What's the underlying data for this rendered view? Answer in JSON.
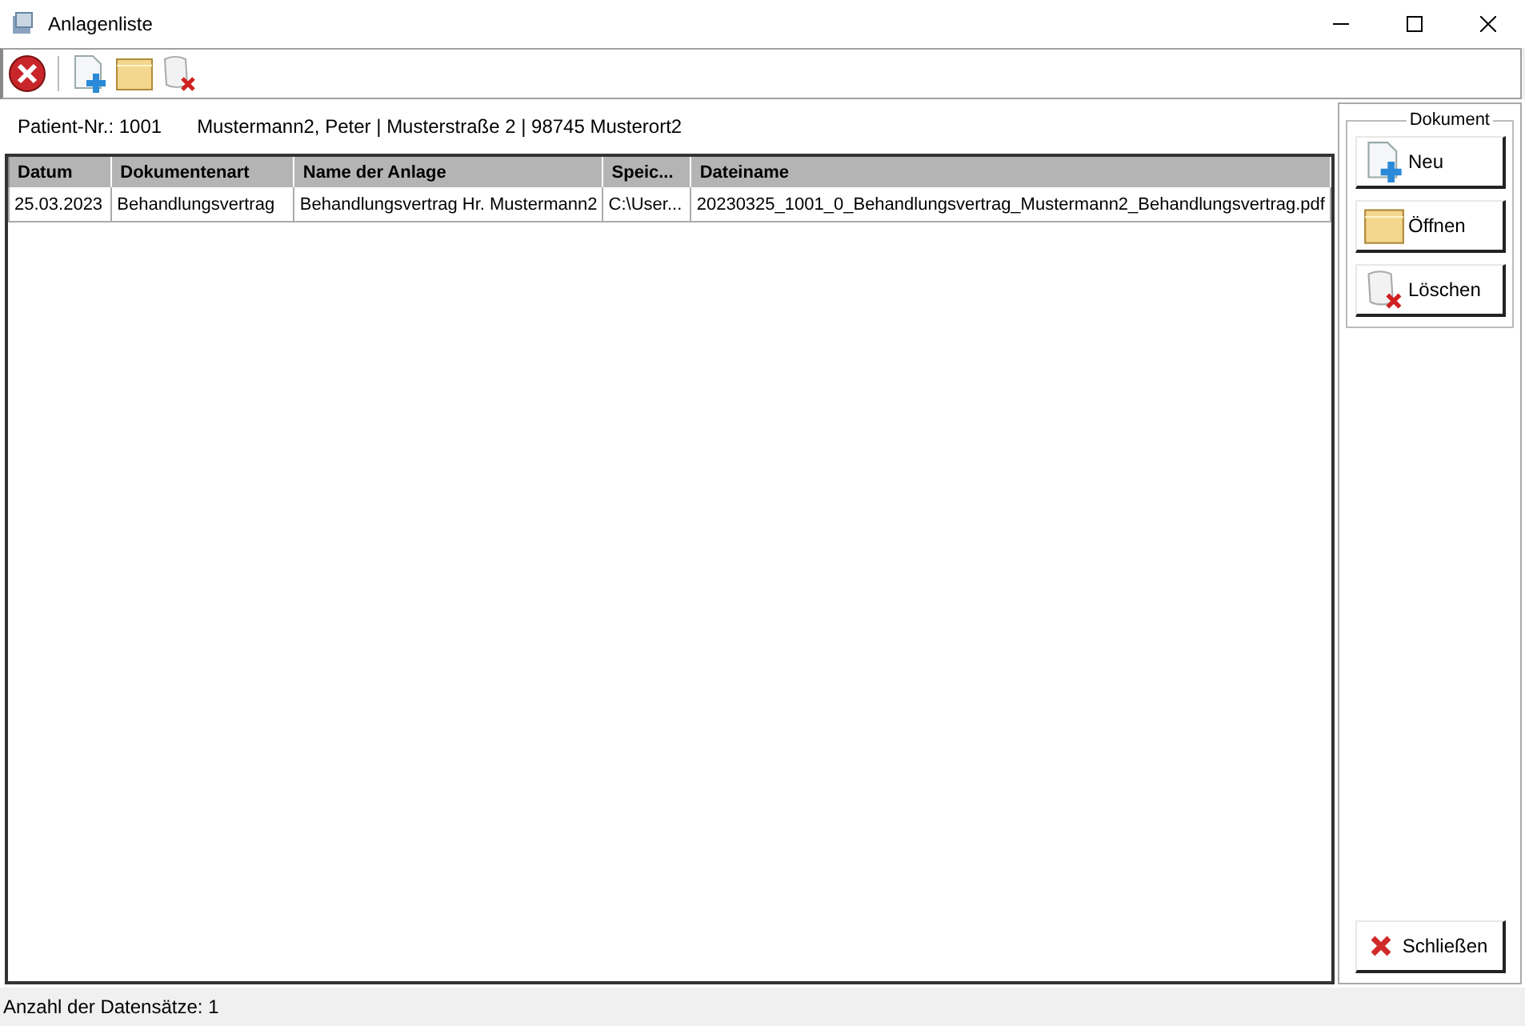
{
  "window": {
    "title": "Anlagenliste"
  },
  "toolbar": [
    {
      "kind": "close"
    },
    {
      "kind": "separator"
    },
    {
      "kind": "new"
    },
    {
      "kind": "open"
    },
    {
      "kind": "delete"
    }
  ],
  "patient": {
    "number_label": "Patient-Nr.: 1001",
    "details": "Mustermann2, Peter | Musterstraße 2 | 98745 Musterort2"
  },
  "table": {
    "columns": [
      "Datum",
      "Dokumentenart",
      "Name der Anlage",
      "Speic...",
      "Dateiname"
    ],
    "rows": [
      [
        "25.03.2023",
        "Behandlungsvertrag",
        "Behandlungsvertrag Hr. Mustermann2",
        "C:\\User...",
        "20230325_1001_0_Behandlungsvertrag_Mustermann2_Behandlungsvertrag.pdf"
      ]
    ]
  },
  "document_group": {
    "title": "Dokument",
    "buttons": [
      {
        "kind": "new",
        "label": "Neu"
      },
      {
        "kind": "open",
        "label": "Öffnen"
      },
      {
        "kind": "delete",
        "label": "Löschen"
      }
    ]
  },
  "close_button": {
    "kind": "close",
    "label": "Schließen"
  },
  "status_bar": "Anzahl der Datensätze: 1"
}
